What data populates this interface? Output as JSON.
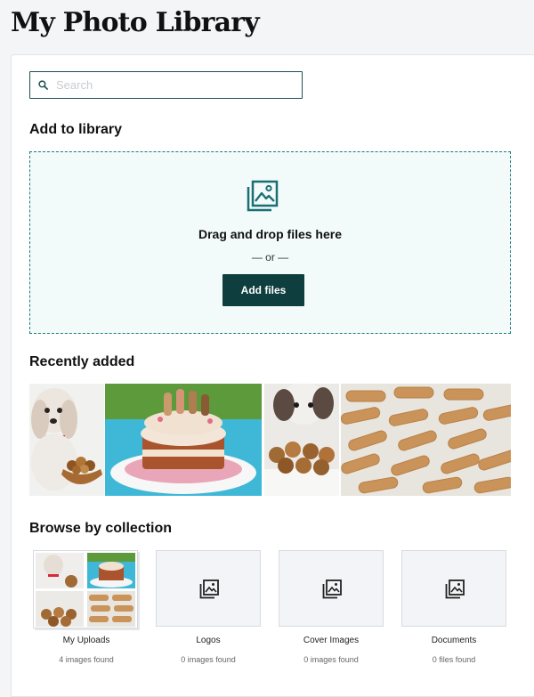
{
  "header": {
    "title": "My Photo Library"
  },
  "search": {
    "placeholder": "Search",
    "value": ""
  },
  "add_section": {
    "heading": "Add to library",
    "drop_text": "Drag and drop files here",
    "or_text": "— or —",
    "button_label": "Add files"
  },
  "recent": {
    "heading": "Recently added",
    "images": [
      "dog-with-treats-photo",
      "dog-birthday-cake-photo",
      "puppy-with-muffins-photo",
      "bone-biscuits-photo"
    ]
  },
  "collections": {
    "heading": "Browse by collection",
    "items": [
      {
        "label": "My Uploads",
        "count": "4 images found"
      },
      {
        "label": "Logos",
        "count": "0 images found"
      },
      {
        "label": "Cover Images",
        "count": "0 images found"
      },
      {
        "label": "Documents",
        "count": "0 files found"
      }
    ]
  },
  "colors": {
    "accent": "#0e3e3e",
    "dropzone_bg": "#f3fafa",
    "dropzone_border": "#1d7a7a",
    "icon_teal": "#1a6f73"
  }
}
